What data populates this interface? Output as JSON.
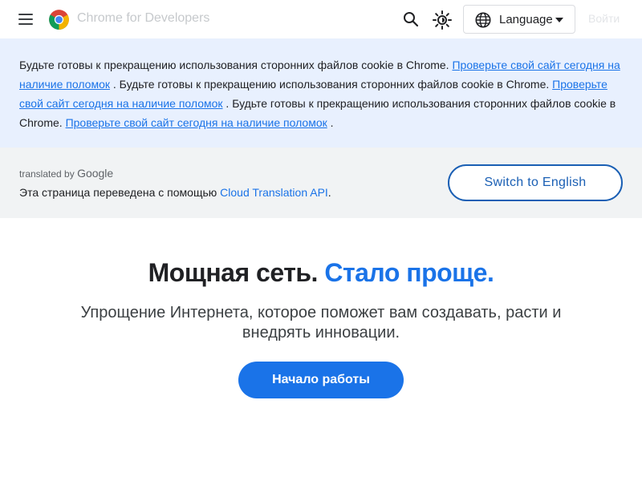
{
  "header": {
    "brand": "Chrome for Developers",
    "language_label": "Language",
    "signin_label": "Войти",
    "icons": [
      "menu-icon",
      "chrome-logo-icon",
      "search-icon",
      "brightness-icon",
      "globe-icon",
      "caret-down-icon"
    ]
  },
  "banner": {
    "text1": "Будьте готовы к прекращению использования сторонних файлов cookie в Chrome. ",
    "link1": "Проверьте свой сайт сегодня на наличие поломок",
    "text2": " . Будьте готовы к прекращению использования сторонних файлов cookie в Chrome. ",
    "link2": "Проверьте свой сайт сегодня на наличие поломок",
    "text3": " . Будьте готовы к прекращению использования сторонних файлов cookie в Chrome. ",
    "link3": "Проверьте свой сайт сегодня на наличие поломок",
    "text4": " ."
  },
  "translation": {
    "translated_by": "translated by",
    "google": "Google",
    "note_prefix": "Эта страница переведена с помощью ",
    "api_link": "Cloud Translation API",
    "note_suffix": ".",
    "switch_label": "Switch to English"
  },
  "hero": {
    "title_main": "Мощная сеть.",
    "title_accent": "Стало проще.",
    "subtitle": "Упрощение Интернета, которое поможет вам создавать, расти и внедрять инновации.",
    "cta_label": "Начало работы"
  },
  "colors": {
    "accent": "#1a73e8",
    "banner_bg": "#e8f0fe",
    "translate_bg": "#f1f3f4",
    "text": "#202124"
  }
}
